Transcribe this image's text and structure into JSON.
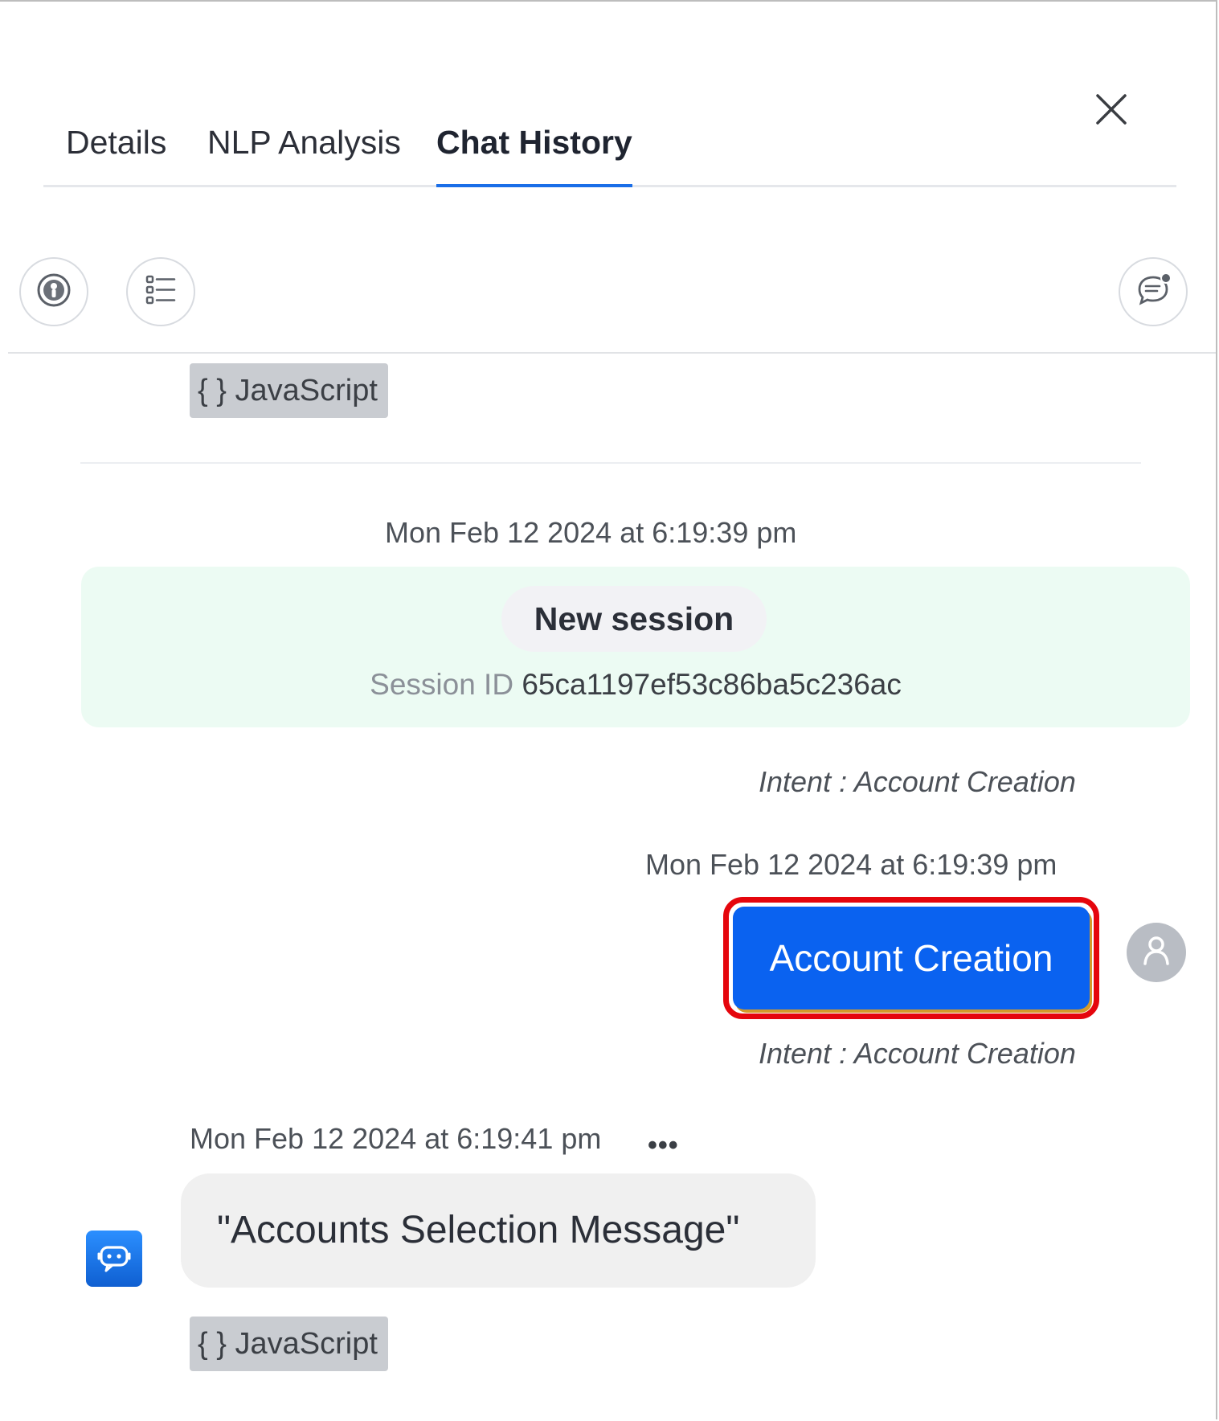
{
  "tabs": [
    {
      "label": "Details",
      "active": false
    },
    {
      "label": "NLP Analysis",
      "active": false
    },
    {
      "label": "Chat History",
      "active": true
    }
  ],
  "toolbar": {
    "left_icons": [
      "user-status-icon",
      "list-icon"
    ],
    "right_icon": "chat-notification-icon"
  },
  "close_icon": "close-icon",
  "messages": {
    "js_tag_top": "{ } JavaScript",
    "session": {
      "timestamp": "Mon Feb 12 2024 at 6:19:39 pm",
      "pill_label": "New session",
      "id_label": "Session ID",
      "id_value": "65ca1197ef53c86ba5c236ac"
    },
    "intent_1": "Intent : Account Creation",
    "user_message": {
      "timestamp": "Mon Feb 12 2024 at 6:19:39 pm",
      "text": "Account Creation",
      "intent": "Intent : Account Creation"
    },
    "bot_message": {
      "timestamp": "Mon Feb 12 2024 at 6:19:41 pm",
      "more": "•••",
      "text": "\"Accounts Selection Message\"",
      "js_tag": "{ } JavaScript"
    }
  },
  "colors": {
    "accent": "#1a6ee8",
    "user_bubble": "#0a62f0",
    "highlight_border": "#e5060d",
    "session_bg": "#ecfbf3"
  }
}
